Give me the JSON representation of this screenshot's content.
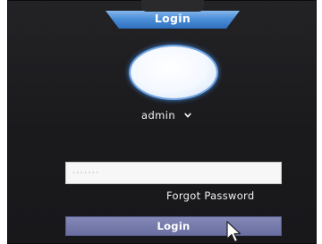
{
  "header": {
    "title": "Login"
  },
  "login_form": {
    "username": "admin",
    "password_placeholder": "·······",
    "forgot_password": "Forgot Password",
    "submit_label": "Login"
  },
  "icons": {
    "avatar": "user-avatar-icon",
    "dropdown": "chevron-down-icon",
    "cursor": "mouse-pointer-icon"
  },
  "colors": {
    "banner_accent": "#4b8fd8",
    "button_bg": "#6a6ea1",
    "background": "#1c1c1f"
  }
}
